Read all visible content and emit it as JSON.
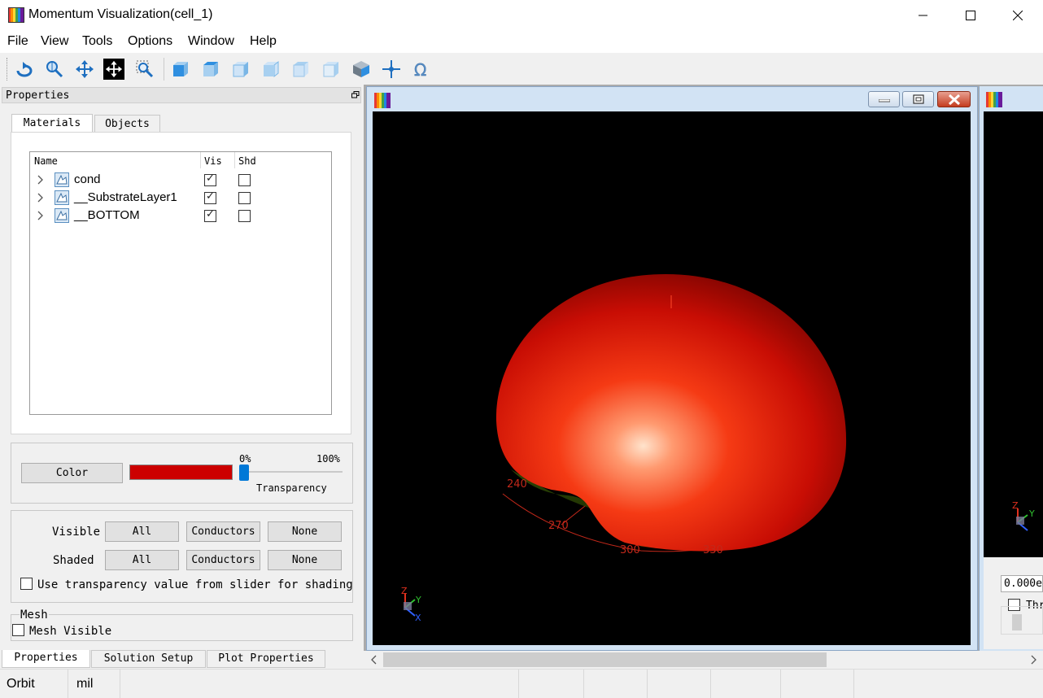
{
  "window": {
    "title": "Momentum Visualization(cell_1)",
    "app_icon": "rainbow-app-icon",
    "controls": [
      "minimize-icon",
      "maximize-icon",
      "close-icon"
    ]
  },
  "menu": [
    "File",
    "View",
    "Tools",
    "Options",
    "Window",
    "Help"
  ],
  "toolbar": [
    {
      "name": "orbit-icon"
    },
    {
      "name": "zoom-icon"
    },
    {
      "name": "pan-icon"
    },
    {
      "name": "fit-view-icon"
    },
    {
      "name": "zoom-box-icon"
    },
    {
      "name": "view-front-icon"
    },
    {
      "name": "view-back-icon"
    },
    {
      "name": "view-left-icon"
    },
    {
      "name": "view-right-icon"
    },
    {
      "name": "view-top-icon"
    },
    {
      "name": "view-bottom-icon"
    },
    {
      "name": "view-iso-icon"
    },
    {
      "name": "probe-icon"
    },
    {
      "name": "ohm-icon"
    }
  ],
  "properties": {
    "header": "Properties",
    "tabs": [
      "Materials",
      "Objects"
    ],
    "active_tab": "Materials",
    "columns": [
      "Name",
      "Vis",
      "Shd"
    ],
    "rows": [
      {
        "label": "cond",
        "vis": true,
        "shd": false
      },
      {
        "label": "__SubstrateLayer1",
        "vis": true,
        "shd": false
      },
      {
        "label": "__BOTTOM",
        "vis": true,
        "shd": false
      }
    ],
    "color_button": "Color",
    "color_swatch": "#cc0000",
    "slider_min_label": "0%",
    "slider_max_label": "100%",
    "slider_value": 0,
    "slider_caption": "Transparency",
    "visible_label": "Visible",
    "shaded_label": "Shaded",
    "btn_all": "All",
    "btn_conductors": "Conductors",
    "btn_none": "None",
    "use_transparency_label": "Use transparency value from slider for shading",
    "mesh_group_label": "Mesh",
    "mesh_visible_label": "Mesh Visible"
  },
  "bottom_tabs": [
    "Properties",
    "Solution Setup",
    "Plot Properties"
  ],
  "status": {
    "mode": "Orbit",
    "units": "mil"
  },
  "plot": {
    "angle_labels": [
      "240",
      "270",
      "300",
      "330"
    ],
    "axis_labels": {
      "x": "X",
      "y": "Y",
      "z": "Z"
    },
    "surface_color": "#e01a0a"
  },
  "second_window": {
    "value_field": "0.000e",
    "checkbox_label": "Thr"
  }
}
